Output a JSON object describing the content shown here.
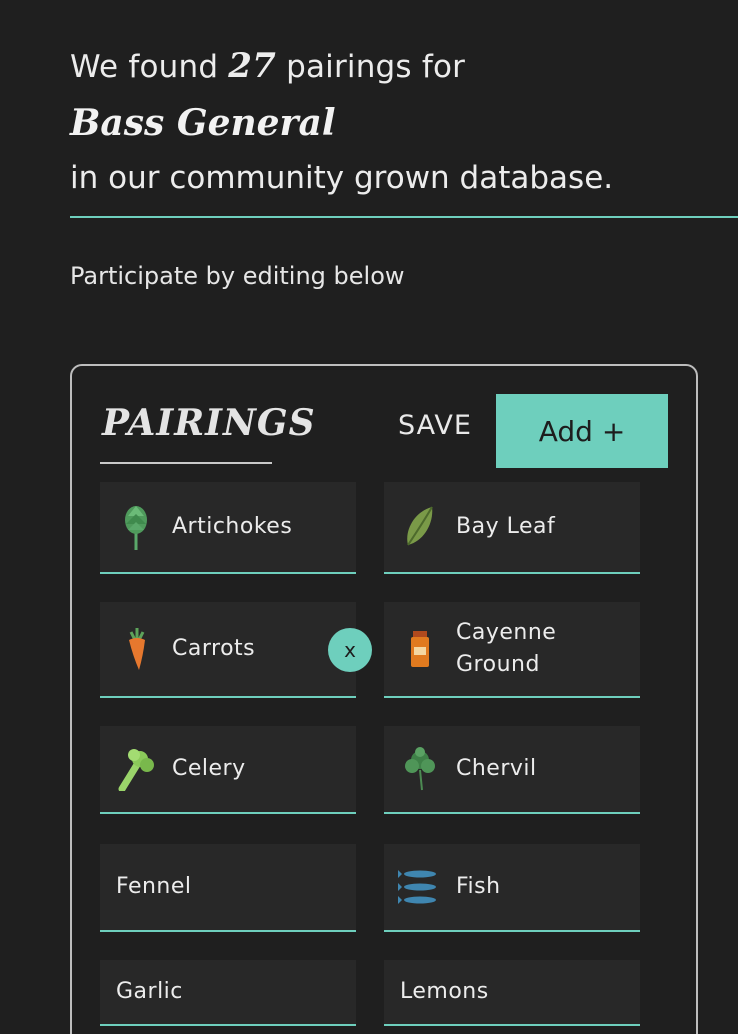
{
  "intro": {
    "prefix": "We found",
    "count": "27",
    "suffix": "pairings for",
    "ingredient": "Bass General",
    "line3": "in our community grown database."
  },
  "participate_text": "Participate by editing below",
  "panel": {
    "title": "PAIRINGS",
    "save_label": "SAVE",
    "add_label": "Add +",
    "remove_label": "x"
  },
  "pairings": [
    {
      "label": "Artichokes",
      "icon": "artichoke-icon"
    },
    {
      "label": "Bay Leaf",
      "icon": "bay-leaf-icon"
    },
    {
      "label": "Carrots",
      "icon": "carrot-icon"
    },
    {
      "label": "Cayenne Ground",
      "icon": "spice-jar-icon"
    },
    {
      "label": "Celery",
      "icon": "celery-icon"
    },
    {
      "label": "Chervil",
      "icon": "chervil-icon"
    },
    {
      "label": "Fennel",
      "icon": ""
    },
    {
      "label": "Fish",
      "icon": "fish-icon"
    },
    {
      "label": "Garlic",
      "icon": ""
    },
    {
      "label": "Lemons",
      "icon": ""
    }
  ],
  "colors": {
    "accent": "#6ecfbd",
    "background": "#1f1f1f",
    "card": "#282828"
  }
}
